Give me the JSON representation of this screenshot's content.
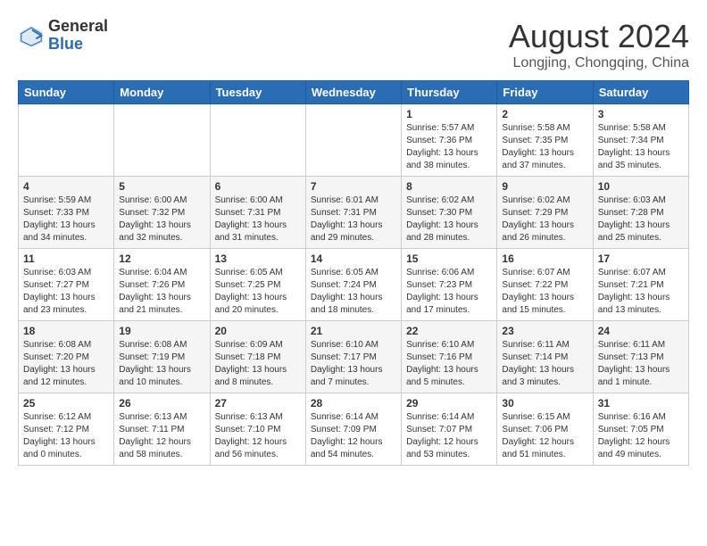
{
  "header": {
    "logo_general": "General",
    "logo_blue": "Blue",
    "title": "August 2024",
    "subtitle": "Longjing, Chongqing, China"
  },
  "calendar": {
    "days_of_week": [
      "Sunday",
      "Monday",
      "Tuesday",
      "Wednesday",
      "Thursday",
      "Friday",
      "Saturday"
    ],
    "weeks": [
      [
        {
          "day": "",
          "info": ""
        },
        {
          "day": "",
          "info": ""
        },
        {
          "day": "",
          "info": ""
        },
        {
          "day": "",
          "info": ""
        },
        {
          "day": "1",
          "info": "Sunrise: 5:57 AM\nSunset: 7:36 PM\nDaylight: 13 hours\nand 38 minutes."
        },
        {
          "day": "2",
          "info": "Sunrise: 5:58 AM\nSunset: 7:35 PM\nDaylight: 13 hours\nand 37 minutes."
        },
        {
          "day": "3",
          "info": "Sunrise: 5:58 AM\nSunset: 7:34 PM\nDaylight: 13 hours\nand 35 minutes."
        }
      ],
      [
        {
          "day": "4",
          "info": "Sunrise: 5:59 AM\nSunset: 7:33 PM\nDaylight: 13 hours\nand 34 minutes."
        },
        {
          "day": "5",
          "info": "Sunrise: 6:00 AM\nSunset: 7:32 PM\nDaylight: 13 hours\nand 32 minutes."
        },
        {
          "day": "6",
          "info": "Sunrise: 6:00 AM\nSunset: 7:31 PM\nDaylight: 13 hours\nand 31 minutes."
        },
        {
          "day": "7",
          "info": "Sunrise: 6:01 AM\nSunset: 7:31 PM\nDaylight: 13 hours\nand 29 minutes."
        },
        {
          "day": "8",
          "info": "Sunrise: 6:02 AM\nSunset: 7:30 PM\nDaylight: 13 hours\nand 28 minutes."
        },
        {
          "day": "9",
          "info": "Sunrise: 6:02 AM\nSunset: 7:29 PM\nDaylight: 13 hours\nand 26 minutes."
        },
        {
          "day": "10",
          "info": "Sunrise: 6:03 AM\nSunset: 7:28 PM\nDaylight: 13 hours\nand 25 minutes."
        }
      ],
      [
        {
          "day": "11",
          "info": "Sunrise: 6:03 AM\nSunset: 7:27 PM\nDaylight: 13 hours\nand 23 minutes."
        },
        {
          "day": "12",
          "info": "Sunrise: 6:04 AM\nSunset: 7:26 PM\nDaylight: 13 hours\nand 21 minutes."
        },
        {
          "day": "13",
          "info": "Sunrise: 6:05 AM\nSunset: 7:25 PM\nDaylight: 13 hours\nand 20 minutes."
        },
        {
          "day": "14",
          "info": "Sunrise: 6:05 AM\nSunset: 7:24 PM\nDaylight: 13 hours\nand 18 minutes."
        },
        {
          "day": "15",
          "info": "Sunrise: 6:06 AM\nSunset: 7:23 PM\nDaylight: 13 hours\nand 17 minutes."
        },
        {
          "day": "16",
          "info": "Sunrise: 6:07 AM\nSunset: 7:22 PM\nDaylight: 13 hours\nand 15 minutes."
        },
        {
          "day": "17",
          "info": "Sunrise: 6:07 AM\nSunset: 7:21 PM\nDaylight: 13 hours\nand 13 minutes."
        }
      ],
      [
        {
          "day": "18",
          "info": "Sunrise: 6:08 AM\nSunset: 7:20 PM\nDaylight: 13 hours\nand 12 minutes."
        },
        {
          "day": "19",
          "info": "Sunrise: 6:08 AM\nSunset: 7:19 PM\nDaylight: 13 hours\nand 10 minutes."
        },
        {
          "day": "20",
          "info": "Sunrise: 6:09 AM\nSunset: 7:18 PM\nDaylight: 13 hours\nand 8 minutes."
        },
        {
          "day": "21",
          "info": "Sunrise: 6:10 AM\nSunset: 7:17 PM\nDaylight: 13 hours\nand 7 minutes."
        },
        {
          "day": "22",
          "info": "Sunrise: 6:10 AM\nSunset: 7:16 PM\nDaylight: 13 hours\nand 5 minutes."
        },
        {
          "day": "23",
          "info": "Sunrise: 6:11 AM\nSunset: 7:14 PM\nDaylight: 13 hours\nand 3 minutes."
        },
        {
          "day": "24",
          "info": "Sunrise: 6:11 AM\nSunset: 7:13 PM\nDaylight: 13 hours\nand 1 minute."
        }
      ],
      [
        {
          "day": "25",
          "info": "Sunrise: 6:12 AM\nSunset: 7:12 PM\nDaylight: 13 hours\nand 0 minutes."
        },
        {
          "day": "26",
          "info": "Sunrise: 6:13 AM\nSunset: 7:11 PM\nDaylight: 12 hours\nand 58 minutes."
        },
        {
          "day": "27",
          "info": "Sunrise: 6:13 AM\nSunset: 7:10 PM\nDaylight: 12 hours\nand 56 minutes."
        },
        {
          "day": "28",
          "info": "Sunrise: 6:14 AM\nSunset: 7:09 PM\nDaylight: 12 hours\nand 54 minutes."
        },
        {
          "day": "29",
          "info": "Sunrise: 6:14 AM\nSunset: 7:07 PM\nDaylight: 12 hours\nand 53 minutes."
        },
        {
          "day": "30",
          "info": "Sunrise: 6:15 AM\nSunset: 7:06 PM\nDaylight: 12 hours\nand 51 minutes."
        },
        {
          "day": "31",
          "info": "Sunrise: 6:16 AM\nSunset: 7:05 PM\nDaylight: 12 hours\nand 49 minutes."
        }
      ]
    ]
  }
}
